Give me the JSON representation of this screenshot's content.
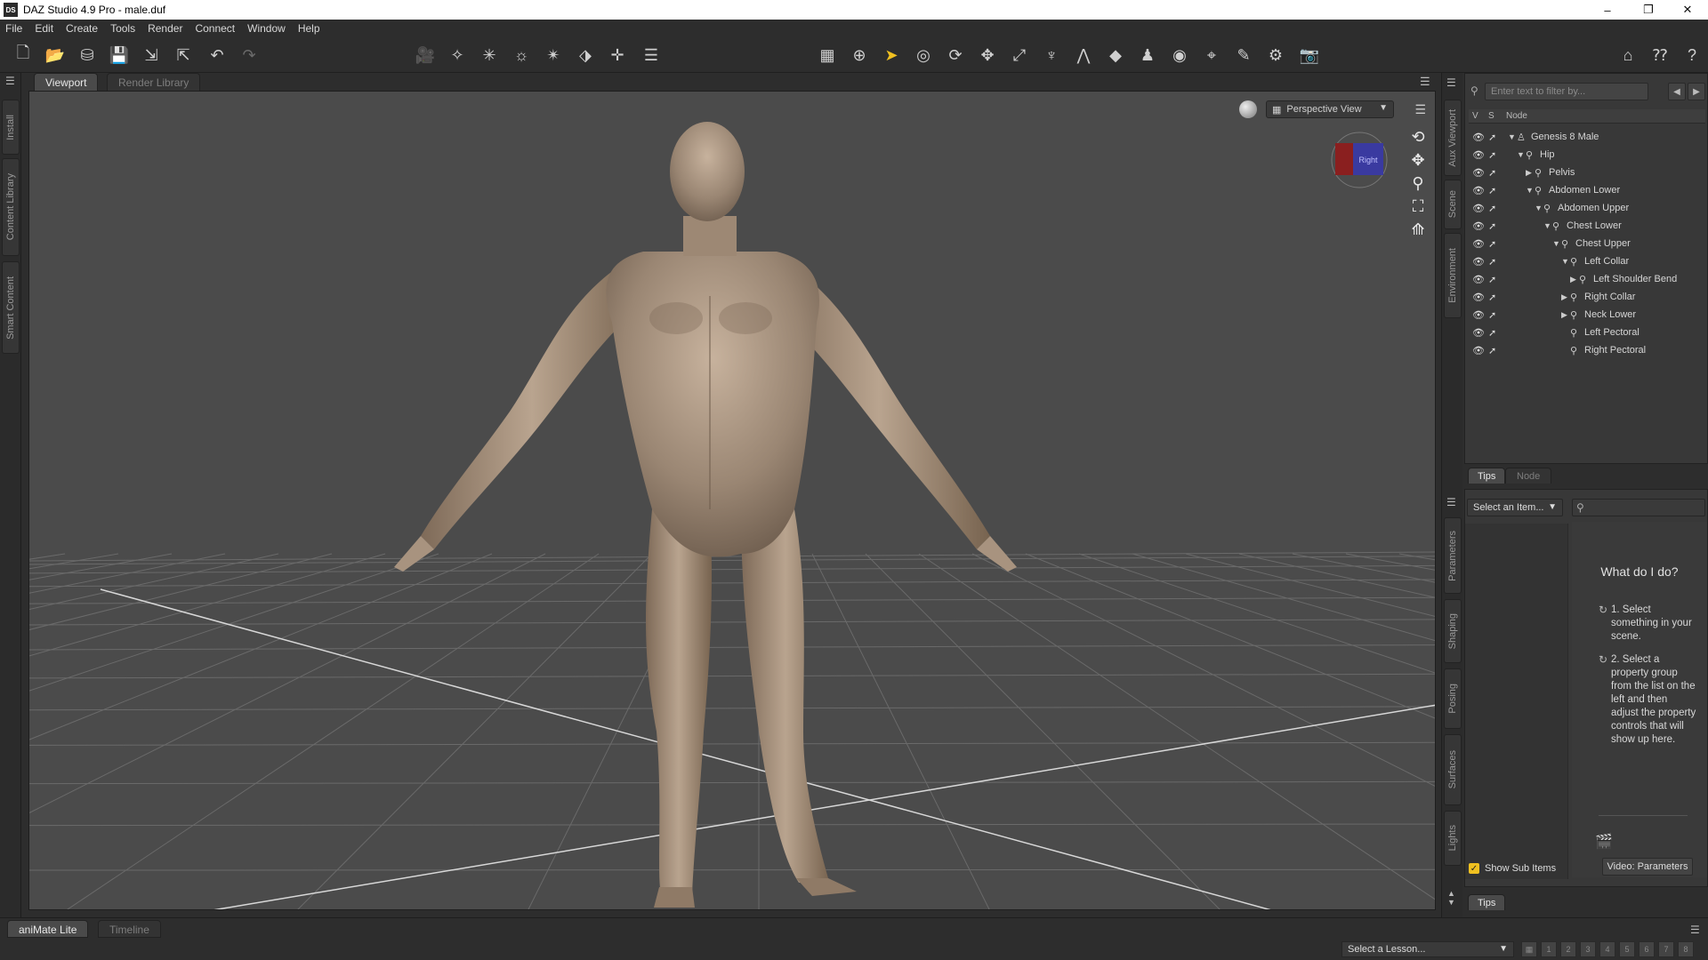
{
  "window": {
    "title": "DAZ Studio 4.9 Pro - male.duf",
    "app_icon": "DS",
    "controls": {
      "minimize": "–",
      "maximize": "❐",
      "close": "✕"
    }
  },
  "menu": [
    "File",
    "Edit",
    "Create",
    "Tools",
    "Render",
    "Connect",
    "Window",
    "Help"
  ],
  "left_tabs": [
    "Install",
    "Content Library",
    "Smart Content"
  ],
  "viewport": {
    "tabs": [
      "Viewport",
      "Render Library"
    ],
    "view_select": "Perspective View",
    "cube_label": "Right"
  },
  "right_tabs_upper": [
    "Aux Viewport",
    "Scene",
    "Environment"
  ],
  "right_tabs_lower": [
    "Parameters",
    "Shaping",
    "Posing",
    "Surfaces",
    "Lights"
  ],
  "scene": {
    "filter_placeholder": "Enter text to filter by...",
    "header": {
      "v": "V",
      "s": "S",
      "node": "Node"
    },
    "nodes": [
      {
        "label": "Genesis 8 Male",
        "depth": 0,
        "expanded": true,
        "figure": true
      },
      {
        "label": "Hip",
        "depth": 1,
        "expanded": true
      },
      {
        "label": "Pelvis",
        "depth": 2,
        "expanded": false
      },
      {
        "label": "Abdomen Lower",
        "depth": 2,
        "expanded": true
      },
      {
        "label": "Abdomen Upper",
        "depth": 3,
        "expanded": true
      },
      {
        "label": "Chest Lower",
        "depth": 4,
        "expanded": true
      },
      {
        "label": "Chest Upper",
        "depth": 5,
        "expanded": true
      },
      {
        "label": "Left Collar",
        "depth": 6,
        "expanded": true
      },
      {
        "label": "Left Shoulder Bend",
        "depth": 7,
        "expanded": false
      },
      {
        "label": "Right Collar",
        "depth": 6,
        "expanded": false
      },
      {
        "label": "Neck Lower",
        "depth": 6,
        "expanded": false
      },
      {
        "label": "Left Pectoral",
        "depth": 6,
        "leaf": true
      },
      {
        "label": "Right Pectoral",
        "depth": 6,
        "leaf": true
      }
    ]
  },
  "tips_tabs": [
    "Tips",
    "Node"
  ],
  "params": {
    "select_item": "Select an Item...",
    "what_do": "What do I do?",
    "step1": "1. Select something in your scene.",
    "step2": "2. Select a property group from the list on the left and then adjust the property controls that will show up here.",
    "video_button": "Video: Parameters",
    "show_sub_items": "Show Sub Items",
    "bottom_tab": "Tips"
  },
  "bottom": {
    "tabs": [
      "aniMate Lite",
      "Timeline"
    ],
    "lesson_select": "Select a Lesson...",
    "pages": [
      "1",
      "2",
      "3",
      "4",
      "5",
      "6",
      "7",
      "8"
    ]
  }
}
